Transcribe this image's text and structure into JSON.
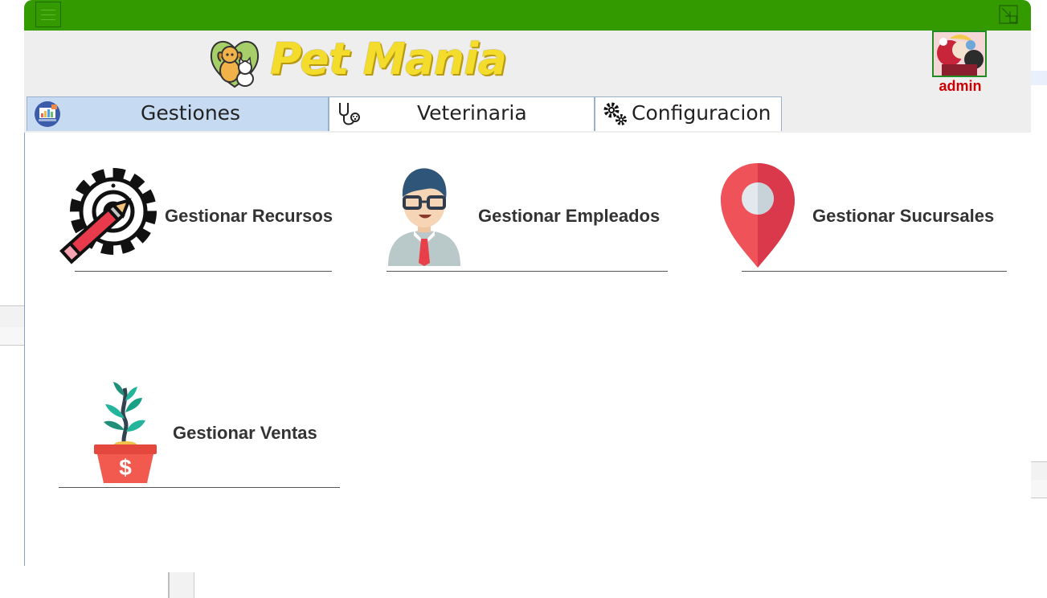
{
  "app": {
    "brand": "Pet Mania",
    "user": {
      "name": "admin"
    }
  },
  "tabs": [
    {
      "label": "Gestiones",
      "icon": "dashboard-icon",
      "active": true
    },
    {
      "label": "Veterinaria",
      "icon": "stethoscope-icon",
      "active": false
    },
    {
      "label": "Configuracion",
      "icon": "gears-icon",
      "active": false
    }
  ],
  "cards": [
    {
      "label": "Gestionar Recursos",
      "icon": "gear-pencil-icon"
    },
    {
      "label": "Gestionar Empleados",
      "icon": "employee-icon"
    },
    {
      "label": "Gestionar Sucursales",
      "icon": "location-pin-icon"
    },
    {
      "label": "Gestionar Ventas",
      "icon": "money-plant-icon"
    }
  ],
  "colors": {
    "titlebar": "#339a00",
    "active_tab": "#c6daf2",
    "user_name": "#cc0000",
    "brand": "#f3dc2b"
  }
}
